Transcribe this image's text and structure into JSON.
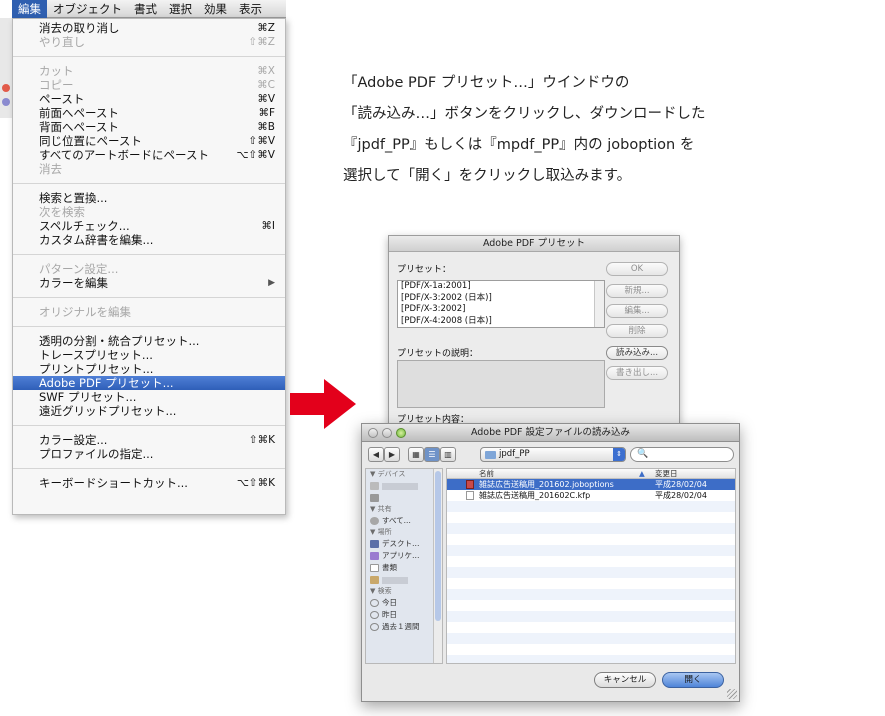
{
  "menubar": {
    "items": [
      "編集",
      "オブジェクト",
      "書式",
      "選択",
      "効果",
      "表示"
    ]
  },
  "edit_menu": {
    "undo": {
      "label": "消去の取り消し",
      "shortcut": "⌘Z"
    },
    "redo": {
      "label": "やり直し",
      "shortcut": "⇧⌘Z"
    },
    "cut": {
      "label": "カット",
      "shortcut": "⌘X"
    },
    "copy": {
      "label": "コピー",
      "shortcut": "⌘C"
    },
    "paste": {
      "label": "ペースト",
      "shortcut": "⌘V"
    },
    "paste_front": {
      "label": "前面へペースト",
      "shortcut": "⌘F"
    },
    "paste_back": {
      "label": "背面へペースト",
      "shortcut": "⌘B"
    },
    "paste_in_place": {
      "label": "同じ位置にペースト",
      "shortcut": "⇧⌘V"
    },
    "paste_all_artboards": {
      "label": "すべてのアートボードにペースト",
      "shortcut": "⌥⇧⌘V"
    },
    "clear": {
      "label": "消去"
    },
    "find_replace": {
      "label": "検索と置換..."
    },
    "find_next": {
      "label": "次を検索"
    },
    "spell_check": {
      "label": "スペルチェック...",
      "shortcut": "⌘I"
    },
    "custom_dictionary": {
      "label": "カスタム辞書を編集..."
    },
    "pattern_settings": {
      "label": "パターン設定..."
    },
    "edit_colors": {
      "label": "カラーを編集",
      "arrow": "▶"
    },
    "edit_original": {
      "label": "オリジナルを編集"
    },
    "transparency_presets": {
      "label": "透明の分割・統合プリセット..."
    },
    "trace_presets": {
      "label": "トレースプリセット..."
    },
    "print_presets": {
      "label": "プリントプリセット..."
    },
    "pdf_presets": {
      "label": "Adobe PDF プリセット..."
    },
    "swf_presets": {
      "label": "SWF プリセット..."
    },
    "perspective_presets": {
      "label": "遠近グリッドプリセット..."
    },
    "color_settings": {
      "label": "カラー設定...",
      "shortcut": "⇧⌘K"
    },
    "assign_profile": {
      "label": "プロファイルの指定..."
    },
    "keyboard_shortcuts": {
      "label": "キーボードショートカット...",
      "shortcut": "⌥⇧⌘K"
    }
  },
  "instructions": [
    "「Adobe PDF プリセット…」ウインドウの",
    "「読み込み…」ボタンをクリックし、ダウンロードした",
    "『jpdf_PP』もしくは『mpdf_PP』内の joboption を",
    "選択して「開く」をクリックし取込みます。"
  ],
  "preset_dialog": {
    "title": "Adobe PDF プリセット",
    "presets_label": "プリセット：",
    "presets": [
      "[PDF/X-1a:2001]",
      "[PDF/X-3:2002 (日本)]",
      "[PDF/X-3:2002]",
      "[PDF/X-4:2008 (日本)]"
    ],
    "description_label": "プリセットの説明：",
    "contents_label": "プリセット内容：",
    "buttons": {
      "ok": "OK",
      "new": "新規...",
      "edit": "編集...",
      "delete": "削除",
      "import": "読み込み...",
      "export": "書き出し..."
    }
  },
  "import_dialog": {
    "title": "Adobe PDF 設定ファイルの読み込み",
    "path": "jpdf_PP",
    "search_icon": "🔍",
    "sidebar": {
      "devices_header": "▼ デバイス",
      "shared_header": "▼ 共有",
      "shared_items": [
        "すべて..."
      ],
      "places_header": "▼ 場所",
      "places_items": [
        "デスクト…",
        "アプリケ…",
        "書類"
      ],
      "search_header": "▼ 検索",
      "search_items": [
        "今日",
        "昨日",
        "過去１週間"
      ]
    },
    "columns": {
      "name": "名前",
      "date": "変更日"
    },
    "files": [
      {
        "name": "雑誌広告送稿用_201602.joboptions",
        "date": "平成28/02/04",
        "selected": true
      },
      {
        "name": "雑誌広告送稿用_201602C.kfp",
        "date": "平成28/02/04",
        "selected": false
      }
    ],
    "buttons": {
      "cancel": "キャンセル",
      "open": "開く"
    }
  },
  "colors": {
    "highlight": "#2f5fb8",
    "arrow": "#e3001b"
  }
}
